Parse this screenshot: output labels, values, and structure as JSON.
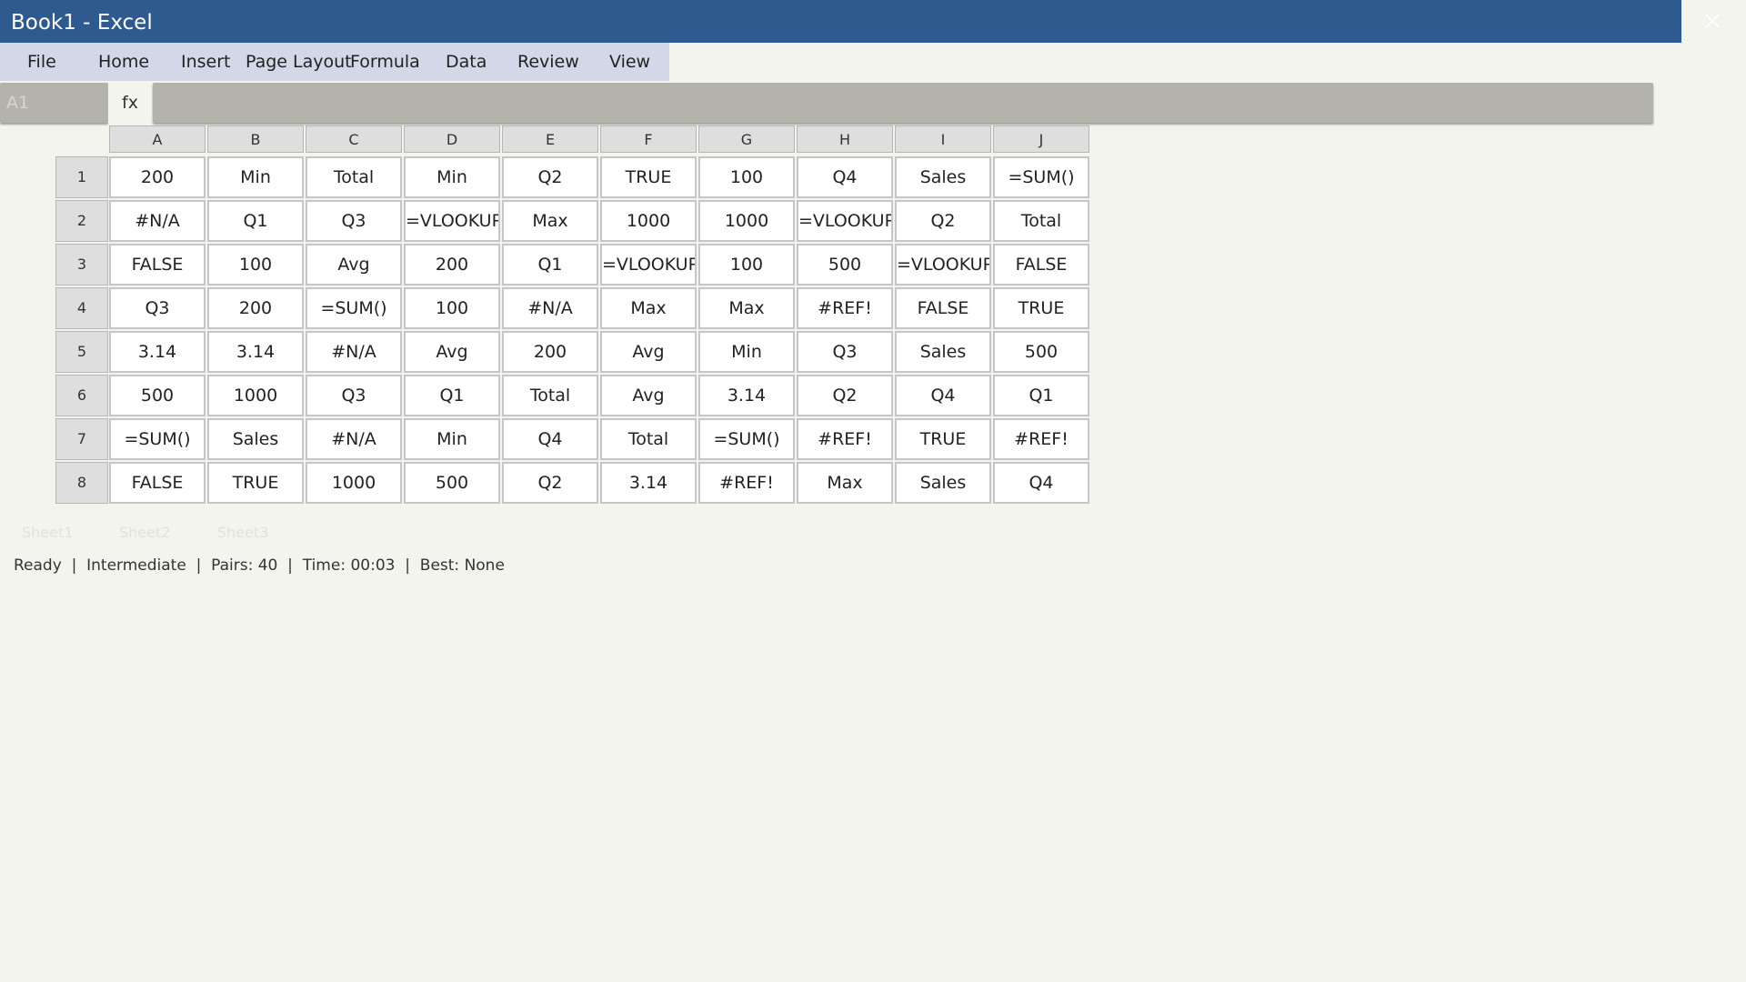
{
  "window": {
    "title": "Book1 - Excel",
    "close_icon": "close-icon"
  },
  "menu": [
    "File",
    "Home",
    "Insert",
    "Page Layout",
    "Formula",
    "Data",
    "Review",
    "View"
  ],
  "formula_bar": {
    "name_box": "A1",
    "fx_label": "fx",
    "value": ""
  },
  "sheet": {
    "columns": [
      "A",
      "B",
      "C",
      "D",
      "E",
      "F",
      "G",
      "H",
      "I",
      "J"
    ],
    "rows": [
      "1",
      "2",
      "3",
      "4",
      "5",
      "6",
      "7",
      "8"
    ],
    "cells": [
      [
        "200",
        "Min",
        "Total",
        "Min",
        "Q2",
        "TRUE",
        "100",
        "Q4",
        "Sales",
        "=SUM()"
      ],
      [
        "#N/A",
        "Q1",
        "Q3",
        "=VLOOKUP(",
        "Max",
        "1000",
        "1000",
        "=VLOOKUP(",
        "Q2",
        "Total"
      ],
      [
        "FALSE",
        "100",
        "Avg",
        "200",
        "Q1",
        "=VLOOKUP(",
        "100",
        "500",
        "=VLOOKUP(",
        "FALSE"
      ],
      [
        "Q3",
        "200",
        "=SUM()",
        "100",
        "#N/A",
        "Max",
        "Max",
        "#REF!",
        "FALSE",
        "TRUE"
      ],
      [
        "3.14",
        "3.14",
        "#N/A",
        "Avg",
        "200",
        "Avg",
        "Min",
        "Q3",
        "Sales",
        "500"
      ],
      [
        "500",
        "1000",
        "Q3",
        "Q1",
        "Total",
        "Avg",
        "3.14",
        "Q2",
        "Q4",
        "Q1"
      ],
      [
        "=SUM()",
        "Sales",
        "#N/A",
        "Min",
        "Q4",
        "Total",
        "=SUM()",
        "#REF!",
        "TRUE",
        "#REF!"
      ],
      [
        "FALSE",
        "TRUE",
        "1000",
        "500",
        "Q2",
        "3.14",
        "#REF!",
        "Max",
        "Sales",
        "Q4"
      ]
    ]
  },
  "sheet_tabs": [
    "Sheet1",
    "Sheet2",
    "Sheet3"
  ],
  "status": {
    "text": "Ready  |  Intermediate  |  Pairs: 40  |  Time: 00:03  |  Best: None"
  },
  "colors": {
    "titlebar": "#2f5a8f",
    "menubar": "#d2d8e8",
    "background": "#f4f4ef",
    "formula_bar": "#b3b3ac"
  }
}
